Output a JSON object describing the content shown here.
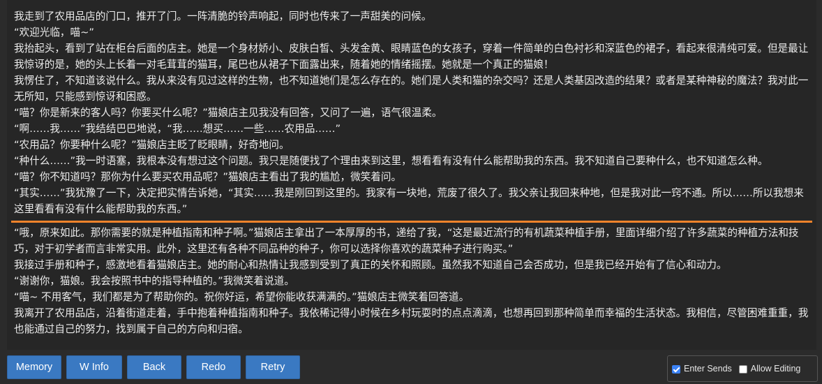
{
  "story": {
    "before_divider": [
      "我走到了农用品店的门口，推开了门。一阵清脆的铃声响起，同时也传来了一声甜美的问候。",
      "“欢迎光临，喵~”",
      "我抬起头，看到了站在柜台后面的店主。她是一个身材娇小、皮肤白皙、头发金黄、眼睛蓝色的女孩子，穿着一件简单的白色衬衫和深蓝色的裙子，看起来很清纯可爱。但是最让我惊讶的是，她的头上长着一对毛茸茸的猫耳，尾巴也从裙子下面露出来，随着她的情绪摇摆。她就是一个真正的猫娘！",
      "我愣住了，不知道该说什么。我从来没有见过这样的生物，也不知道她们是怎么存在的。她们是人类和猫的杂交吗？还是人类基因改造的结果？或者是某种神秘的魔法？我对此一无所知，只能感到惊讶和困惑。",
      "“喵？你是新来的客人吗？你要买什么呢？”猫娘店主见我没有回答，又问了一遍，语气很温柔。",
      "“啊……我……”我结结巴巴地说，“我……想买……一些……农用品……”",
      "“农用品？你要种什么呢？”猫娘店主眨了眨眼睛，好奇地问。",
      "“种什么……”我一时语塞，我根本没有想过这个问题。我只是随便找了个理由来到这里，想看看有没有什么能帮助我的东西。我不知道自己要种什么，也不知道怎么种。",
      "“喵？你不知道吗？那你为什么要买农用品呢？”猫娘店主看出了我的尴尬，微笑着问。",
      "“其实……”我犹豫了一下，决定把实情告诉她，“其实……我是刚回到这里的。我家有一块地，荒废了很久了。我父亲让我回来种地，但是我对此一窍不通。所以……所以我想来这里看看有没有什么能帮助我的东西。”"
    ],
    "after_divider": [
      "“哦，原来如此。那你需要的就是种植指南和种子啊。”猫娘店主拿出了一本厚厚的书，递给了我，“这是最近流行的有机蔬菜种植手册，里面详细介绍了许多蔬菜的种植方法和技巧，对于初学者而言非常实用。此外，这里还有各种不同品种的种子，你可以选择你喜欢的蔬菜种子进行购买。”",
      "我接过手册和种子，感激地看着猫娘店主。她的耐心和热情让我感到受到了真正的关怀和照顾。虽然我不知道自己会否成功，但是我已经开始有了信心和动力。",
      "“谢谢你，猫娘。我会按照书中的指导种植的。”我微笑着说道。",
      "“喵~ 不用客气，我们都是为了帮助你的。祝你好运，希望你能收获满满的。”猫娘店主微笑着回答道。",
      "我离开了农用品店，沿着街道走着，手中抱着种植指南和种子。我依稀记得小时候在乡村玩耍时的点点滴滴，也想再回到那种简单而幸福的生活状态。我相信，尽管困难重重，我也能通过自己的努力，找到属于自己的方向和归宿。"
    ]
  },
  "toolbar": {
    "memory": "Memory",
    "winfo": "W Info",
    "back": "Back",
    "redo": "Redo",
    "retry": "Retry"
  },
  "options": {
    "enter_sends": {
      "label": "Enter Sends",
      "checked": true
    },
    "allow_editing": {
      "label": "Allow Editing",
      "checked": false
    }
  },
  "colors": {
    "accent_button": "#3a79c2",
    "divider": "#f0832b",
    "checkbox_checked": "#3b82f6"
  }
}
